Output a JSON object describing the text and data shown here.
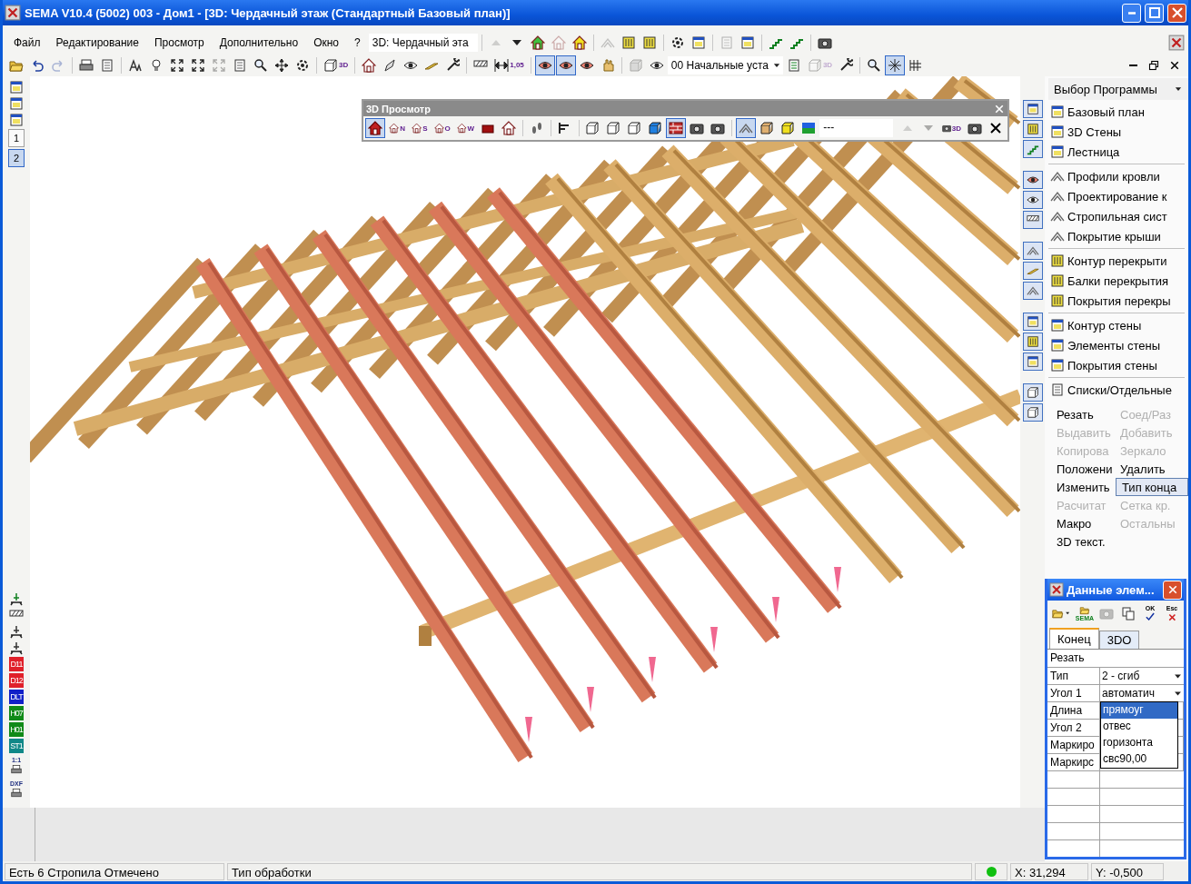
{
  "window": {
    "title": "SEMA V10.4 (5002) 003 - Дом1  - [3D: Чердачный этаж (Стандартный Базовый план)]"
  },
  "menu": [
    {
      "label": "Файл"
    },
    {
      "label": "Редактирование"
    },
    {
      "label": "Просмотр"
    },
    {
      "label": "Дополнительно"
    },
    {
      "label": "Окно"
    },
    {
      "label": "?"
    }
  ],
  "view_combo": {
    "value": "3D: Чердачный эта"
  },
  "menu_toolbar": [
    {
      "disabled": true
    },
    {
      "disabled": false
    },
    {
      "disabled": false
    },
    {
      "disabled": true
    },
    {
      "disabled": false
    },
    {
      "disabled": true
    },
    {
      "disabled": false
    },
    {
      "disabled": false
    },
    {
      "disabled": false
    },
    {
      "disabled": false
    },
    {
      "disabled": true
    },
    {
      "disabled": false
    },
    {
      "disabled": false
    },
    {
      "disabled": false
    },
    {
      "disabled": false
    }
  ],
  "main_toolbar": [
    {
      "pressed": false,
      "disabled": false
    },
    {
      "pressed": false,
      "disabled": false
    },
    {
      "pressed": false,
      "disabled": true
    },
    {
      "pressed": false,
      "disabled": false
    },
    {
      "pressed": false,
      "disabled": false
    },
    {
      "pressed": false,
      "disabled": false
    },
    {
      "pressed": false,
      "disabled": false
    },
    {
      "pressed": false,
      "disabled": false
    },
    {
      "pressed": false,
      "disabled": false
    },
    {
      "pressed": false,
      "disabled": true
    },
    {
      "pressed": false,
      "disabled": false
    },
    {
      "pressed": false,
      "disabled": false
    },
    {
      "pressed": false,
      "disabled": false
    },
    {
      "pressed": false,
      "disabled": false
    },
    {
      "pressed": false,
      "disabled": false,
      "label": "3D"
    },
    {
      "pressed": false,
      "disabled": false
    },
    {
      "pressed": false,
      "disabled": false
    },
    {
      "pressed": false,
      "disabled": false
    },
    {
      "pressed": false,
      "disabled": false
    },
    {
      "pressed": false,
      "disabled": false
    },
    {
      "pressed": false,
      "disabled": false
    },
    {
      "pressed": false,
      "disabled": false,
      "label": "1,05"
    },
    {
      "pressed": true,
      "disabled": false
    },
    {
      "pressed": true,
      "disabled": false
    },
    {
      "pressed": false,
      "disabled": false
    },
    {
      "pressed": false,
      "disabled": false
    },
    {
      "pressed": false,
      "disabled": true
    },
    {
      "pressed": false,
      "disabled": false
    },
    {
      "pressed": false,
      "disabled": false
    },
    {
      "pressed": false,
      "disabled": true,
      "label": "3D"
    },
    {
      "pressed": false,
      "disabled": false
    },
    {
      "pressed": false,
      "disabled": false
    },
    {
      "pressed": true,
      "disabled": false
    },
    {
      "pressed": false,
      "disabled": false
    }
  ],
  "style_combo": {
    "value": "00 Начальные уста"
  },
  "view3d_toolbar": {
    "title": "3D Просмотр",
    "field": "---",
    "buttons": [
      {
        "pressed": true,
        "disabled": false
      },
      {
        "pressed": false,
        "disabled": false,
        "label": "N"
      },
      {
        "pressed": false,
        "disabled": false,
        "label": "S"
      },
      {
        "pressed": false,
        "disabled": false,
        "label": "O"
      },
      {
        "pressed": false,
        "disabled": false,
        "label": "W"
      },
      {
        "pressed": false,
        "disabled": false
      },
      {
        "pressed": false,
        "disabled": false
      },
      {
        "pressed": false,
        "disabled": false
      },
      {
        "pressed": false,
        "disabled": false
      },
      {
        "pressed": false,
        "disabled": false
      },
      {
        "pressed": false,
        "disabled": false
      },
      {
        "pressed": false,
        "disabled": false
      },
      {
        "pressed": false,
        "disabled": false
      },
      {
        "pressed": true,
        "disabled": false
      },
      {
        "pressed": false,
        "disabled": false
      },
      {
        "pressed": false,
        "disabled": false
      },
      {
        "pressed": true,
        "disabled": false
      },
      {
        "pressed": false,
        "disabled": false
      },
      {
        "pressed": false,
        "disabled": false
      },
      {
        "pressed": false,
        "disabled": false
      },
      {
        "pressed": false,
        "disabled": true
      },
      {
        "pressed": false,
        "disabled": true
      },
      {
        "pressed": false,
        "disabled": false,
        "label": "3D"
      },
      {
        "pressed": false,
        "disabled": false
      },
      {
        "pressed": false,
        "disabled": false
      }
    ]
  },
  "left_toolbar": {
    "views": [
      {
        "label": "1",
        "selected": false
      },
      {
        "label": "2",
        "selected": true
      }
    ],
    "layers": [
      {
        "label": "D11",
        "color": "#e0202a"
      },
      {
        "label": "D12",
        "color": "#e0202a"
      },
      {
        "label": "DLT",
        "color": "#1020c8"
      },
      {
        "label": "H07",
        "color": "#108a18"
      },
      {
        "label": "H01",
        "color": "#108a18"
      },
      {
        "label": "ST1",
        "color": "#108888"
      }
    ],
    "tools": [
      {
        "label": "1:1"
      },
      {
        "label": "DXF"
      }
    ]
  },
  "program_panel": {
    "selector": "Выбор Программы",
    "groups": [
      [
        {
          "label": "Базовый план"
        },
        {
          "label": "3D Стены"
        },
        {
          "label": "Лестница"
        }
      ],
      [
        {
          "label": "Профили кровли"
        },
        {
          "label": "Проектирование к"
        },
        {
          "label": "Стропильная сист"
        },
        {
          "label": "Покрытие крыши"
        }
      ],
      [
        {
          "label": "Контур перекрыти"
        },
        {
          "label": "Балки перекрытия"
        },
        {
          "label": "Покрытия перекры"
        }
      ],
      [
        {
          "label": "Контур стены"
        },
        {
          "label": "Элементы стены"
        },
        {
          "label": "Покрытия стены"
        }
      ],
      [
        {
          "label": "Списки/Отдельные"
        }
      ]
    ],
    "commands": [
      {
        "label": "Резать",
        "disabled": false,
        "selected": false
      },
      {
        "label": "Соед/Раз",
        "disabled": true,
        "selected": false
      },
      {
        "label": "Выдавить",
        "disabled": true,
        "selected": false
      },
      {
        "label": "Добавить",
        "disabled": true,
        "selected": false
      },
      {
        "label": "Копирова",
        "disabled": true,
        "selected": false
      },
      {
        "label": "Зеркало",
        "disabled": true,
        "selected": false
      },
      {
        "label": "Положени",
        "disabled": false,
        "selected": false
      },
      {
        "label": "Удалить",
        "disabled": false,
        "selected": false
      },
      {
        "label": "Изменить",
        "disabled": false,
        "selected": false
      },
      {
        "label": "Тип конца",
        "disabled": false,
        "selected": true
      },
      {
        "label": "Расчитат",
        "disabled": true,
        "selected": false
      },
      {
        "label": "Сетка кр.",
        "disabled": true,
        "selected": false
      },
      {
        "label": "Макро",
        "disabled": false,
        "selected": false
      },
      {
        "label": "Остальны",
        "disabled": true,
        "selected": false
      },
      {
        "label": "3D текст.",
        "disabled": false,
        "selected": false
      }
    ]
  },
  "data_panel": {
    "title": "Данные элем...",
    "tool_labels": [
      "SEMA",
      "OK",
      "Esc"
    ],
    "tabs": [
      {
        "label": "Конец",
        "selected": true
      },
      {
        "label": "3DO",
        "selected": false
      }
    ],
    "section": "Резать",
    "rows": [
      {
        "name": "Тип",
        "value": "2 - сгиб"
      },
      {
        "name": "Угол 1",
        "value": "автоматич"
      },
      {
        "name": "Длина"
      },
      {
        "name": "Угол 2"
      },
      {
        "name": "Маркиро"
      },
      {
        "name": "Маркирс"
      }
    ],
    "dropdown": [
      {
        "label": "прямоуг",
        "selected": true
      },
      {
        "label": "отвес",
        "selected": false
      },
      {
        "label": "горизонта",
        "selected": false
      },
      {
        "label": "свс90,00",
        "selected": false
      }
    ]
  },
  "status_bar": {
    "message": "Есть 6 Стропила Отмечено",
    "mode": "Тип обработки",
    "x": "X: 31,294",
    "y": "Y: -0,500"
  }
}
